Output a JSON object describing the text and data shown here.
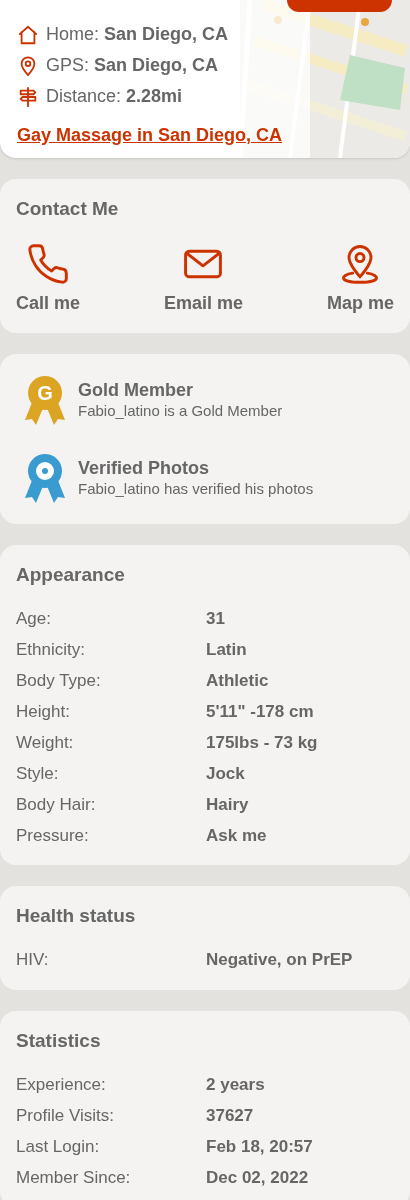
{
  "location": {
    "lines": [
      {
        "kind": "home",
        "label": "Home:",
        "value": "San Diego, CA"
      },
      {
        "kind": "gps",
        "label": "GPS:",
        "value": "San Diego, CA"
      },
      {
        "kind": "distance",
        "label": "Distance:",
        "value": "2.28mi"
      }
    ],
    "link": "Gay Massage in San Diego, CA"
  },
  "contact": {
    "title": "Contact Me",
    "actions": [
      {
        "kind": "call",
        "label": "Call me"
      },
      {
        "kind": "email",
        "label": "Email me"
      },
      {
        "kind": "map",
        "label": "Map me"
      }
    ]
  },
  "badges": [
    {
      "letter": "G",
      "color": "#dba523",
      "title": "Gold Member",
      "text": "Fabio_latino is a Gold Member"
    },
    {
      "color": "#3a9bd0",
      "title": "Verified Photos",
      "text": "Fabio_latino has verified his photos"
    }
  ],
  "sections": [
    {
      "title": "Appearance",
      "rows": [
        {
          "label": "Age:",
          "value": "31"
        },
        {
          "label": "Ethnicity:",
          "value": "Latin"
        },
        {
          "label": "Body Type:",
          "value": "Athletic"
        },
        {
          "label": "Height:",
          "value": "5'11\" -178 cm"
        },
        {
          "label": "Weight:",
          "value": "175lbs - 73 kg"
        },
        {
          "label": "Style:",
          "value": "Jock"
        },
        {
          "label": "Body Hair:",
          "value": "Hairy"
        },
        {
          "label": "Pressure:",
          "value": "Ask me"
        }
      ]
    },
    {
      "title": "Health status",
      "rows": [
        {
          "label": "HIV:",
          "value": "Negative, on PrEP"
        }
      ]
    },
    {
      "title": "Statistics",
      "rows": [
        {
          "label": "Experience:",
          "value": "2 years"
        },
        {
          "label": "Profile Visits:",
          "value": "37627"
        },
        {
          "label": "Last Login:",
          "value": "Feb 18, 20:57"
        },
        {
          "label": "Member Since:",
          "value": "Dec 02, 2022"
        }
      ]
    }
  ]
}
